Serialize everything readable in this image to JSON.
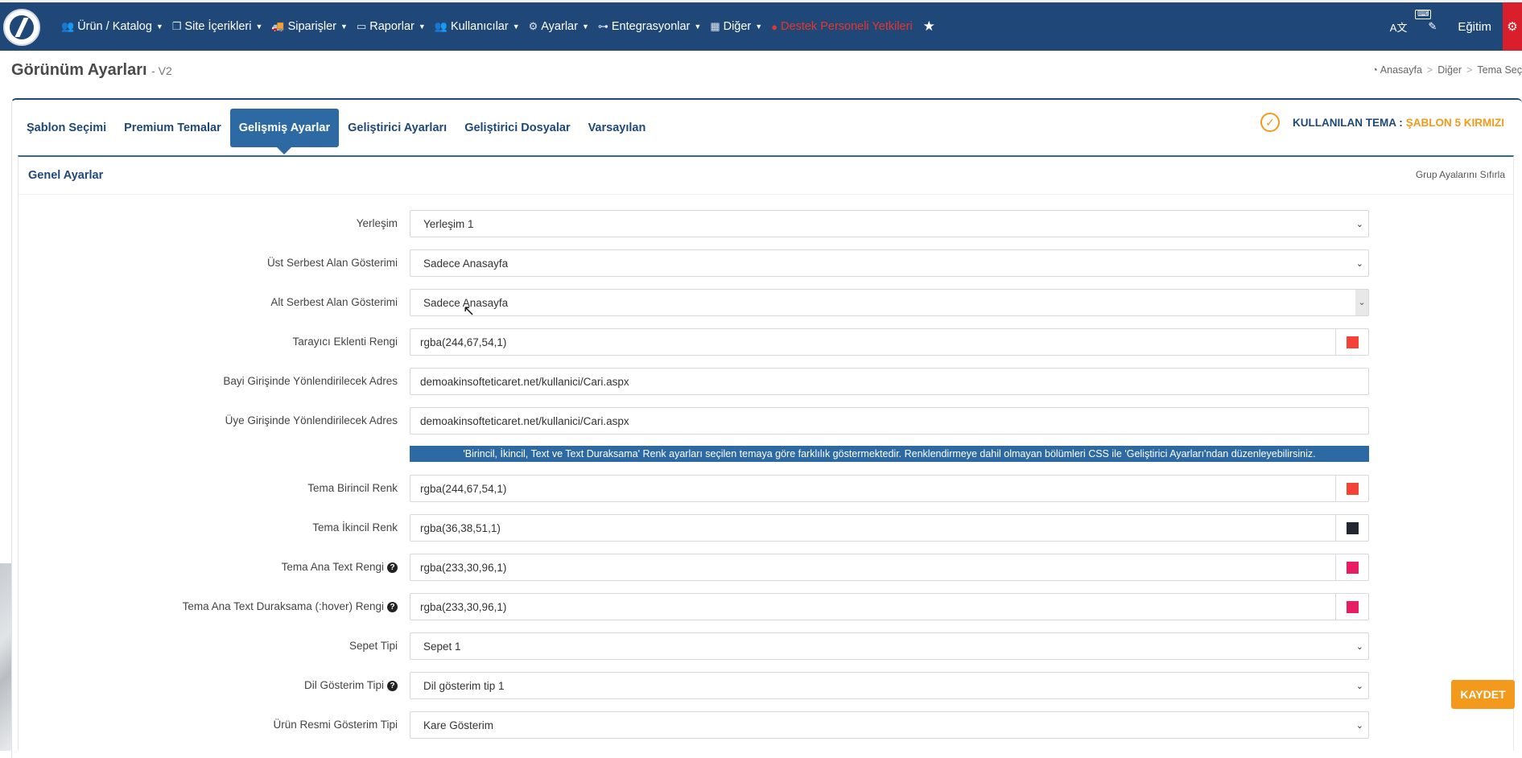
{
  "topbar": {
    "nav": [
      {
        "label": "Ürün / Katalog",
        "icon": "users-icon",
        "glyph": "👥"
      },
      {
        "label": "Site İçerikleri",
        "icon": "copy-icon",
        "glyph": "❐"
      },
      {
        "label": "Siparişler",
        "icon": "truck-icon",
        "glyph": "🚚"
      },
      {
        "label": "Raporlar",
        "icon": "folder-icon",
        "glyph": "▭"
      },
      {
        "label": "Kullanıcılar",
        "icon": "users-icon",
        "glyph": "👥"
      },
      {
        "label": "Ayarlar",
        "icon": "cogs-icon",
        "glyph": "⚙"
      },
      {
        "label": "Entegrasyonlar",
        "icon": "sitemap-icon",
        "glyph": "⊶"
      },
      {
        "label": "Diğer",
        "icon": "grid-icon",
        "glyph": "▦"
      }
    ],
    "support_label": "Destek Personeli Yetkileri",
    "egitim_label": "Eğitim",
    "kbd_label": "⌨",
    "lang_icon_label": "A文",
    "edit_icon_label": "✎"
  },
  "header": {
    "title": "Görünüm Ayarları",
    "version": "- V2",
    "breadcrumb": [
      "Anasayfa",
      "Diğer",
      "Tema Seç"
    ]
  },
  "tabs": [
    {
      "label": "Şablon Seçimi"
    },
    {
      "label": "Premium Temalar"
    },
    {
      "label": "Gelişmiş Ayarlar",
      "active": true
    },
    {
      "label": "Geliştirici Ayarları"
    },
    {
      "label": "Geliştirici Dosyalar"
    },
    {
      "label": "Varsayılan"
    }
  ],
  "theme_status": {
    "label": "KULLANILAN TEMA :",
    "name": "ŞABLON 5 KIRMIZI"
  },
  "panel": {
    "title": "Genel Ayarlar",
    "reset_label": "Grup Ayalarını Sıfırla"
  },
  "form": {
    "yerlesim": {
      "label": "Yerleşim",
      "value": "Yerleşim 1"
    },
    "ust_serbest": {
      "label": "Üst Serbest Alan Gösterimi",
      "value": "Sadece Anasayfa"
    },
    "alt_serbest": {
      "label": "Alt Serbest Alan Gösterimi",
      "value": "Sadece Anasayfa"
    },
    "tarayici_renk": {
      "label": "Tarayıcı Eklenti Rengi",
      "value": "rgba(244,67,54,1)",
      "color": "#f44336"
    },
    "bayi_adres": {
      "label": "Bayi Girişinde Yönlendirilecek Adres",
      "value": "demoakinsofteticaret.net/kullanici/Cari.aspx"
    },
    "uye_adres": {
      "label": "Üye Girişinde Yönlendirilecek Adres",
      "value": "demoakinsofteticaret.net/kullanici/Cari.aspx"
    },
    "info": "'Birincil, İkincil, Text ve Text Duraksama' Renk ayarları seçilen temaya göre farklılık göstermektedir. Renklendirmeye dahil olmayan bölümleri CSS ile 'Geliştirici Ayarları'ndan düzenleyebilirsiniz.",
    "tema_birincil": {
      "label": "Tema Birincil Renk",
      "value": "rgba(244,67,54,1)",
      "color": "#f44336"
    },
    "tema_ikincil": {
      "label": "Tema İkincil Renk",
      "value": "rgba(36,38,51,1)",
      "color": "#242633"
    },
    "tema_text": {
      "label": "Tema Ana Text Rengi",
      "value": "rgba(233,30,96,1)",
      "color": "#e91e60"
    },
    "tema_text_hover": {
      "label": "Tema Ana Text Duraksama (:hover) Rengi",
      "value": "rgba(233,30,96,1)",
      "color": "#e91e60"
    },
    "sepet_tipi": {
      "label": "Sepet Tipi",
      "value": "Sepet 1"
    },
    "dil_gosterim": {
      "label": "Dil Gösterim Tipi",
      "value": "Dil gösterim tip 1"
    },
    "urun_resmi": {
      "label": "Ürün Resmi Gösterim Tipi",
      "value": "Kare Gösterim"
    }
  },
  "save_label": "KAYDET"
}
